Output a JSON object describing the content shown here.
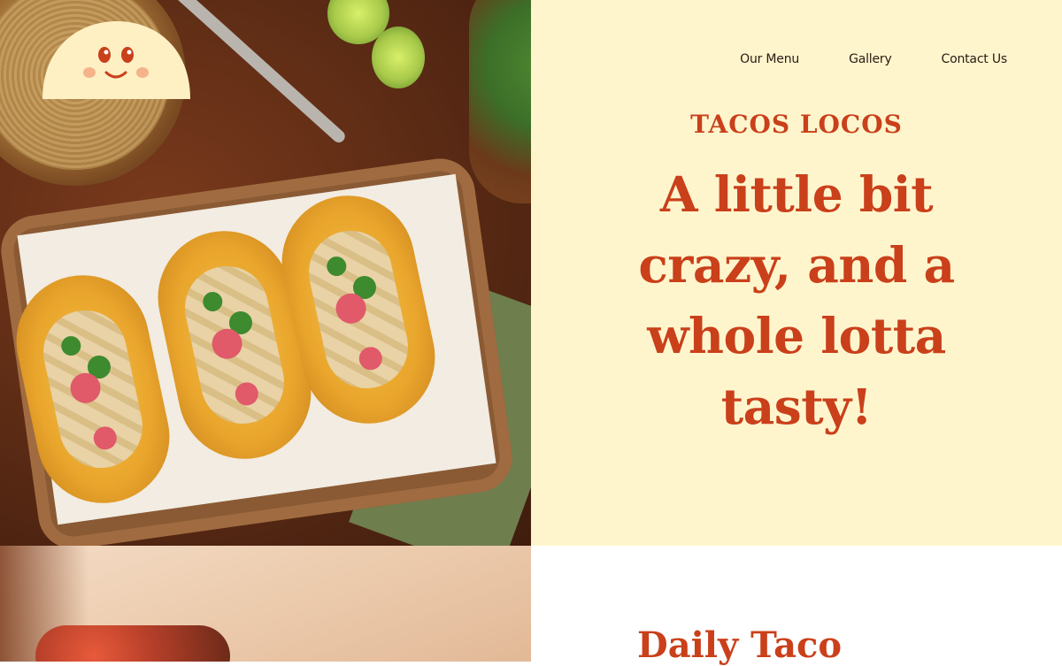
{
  "nav": {
    "items": [
      {
        "label": "Our Menu"
      },
      {
        "label": "Gallery"
      },
      {
        "label": "Contact Us"
      }
    ]
  },
  "hero": {
    "brand": "TACOS LOCOS",
    "headline": "A little bit crazy, and a whole lotta tasty!"
  },
  "section": {
    "title": "Daily Taco"
  },
  "colors": {
    "accent": "#c9401a",
    "panel_bg": "#fff5cd"
  },
  "icons": {
    "logo": "smiling-taco-logo"
  }
}
